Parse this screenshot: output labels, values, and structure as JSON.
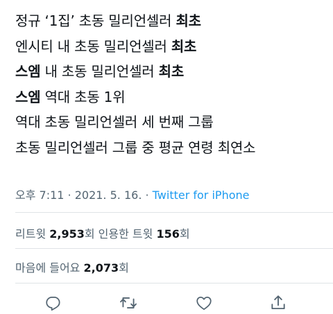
{
  "tweet": {
    "lines": [
      {
        "before": "정규 ‘1집’ 초동 밀리언셀러 ",
        "bold": "최초",
        "after": ""
      },
      {
        "before": "엔시티 내 초동 밀리언셀러 ",
        "bold": "최초",
        "after": ""
      },
      {
        "before": "",
        "bold": "스엠",
        "after": " 내 초동 밀리언셀러 ",
        "bold2": "최초"
      },
      {
        "before": "",
        "bold": "스엠",
        "after": " 역대 초동 1위"
      },
      {
        "before": "역대 초동 밀리언셀러 세 번째 그룹",
        "bold": "",
        "after": ""
      },
      {
        "before": "초동 밀리언셀러 그룹 중 평균 연령 최연소",
        "bold": "",
        "after": ""
      }
    ]
  },
  "meta": {
    "datetime": "오후 7:11 · 2021. 5. 16. · ",
    "source": "Twitter for iPhone"
  },
  "stats": {
    "retweet_label": "리트윗 ",
    "retweet_count": "2,953",
    "retweet_unit": "회  인용한 트윗 ",
    "quote_count": "156",
    "quote_unit": "회",
    "like_label": "마음에 들어요 ",
    "like_count": "2,073",
    "like_unit": "회"
  },
  "actions": {
    "reply_icon": "reply-icon",
    "retweet_icon": "retweet-icon",
    "like_icon": "heart-icon",
    "share_icon": "share-icon",
    "icon_color": "#536471"
  }
}
